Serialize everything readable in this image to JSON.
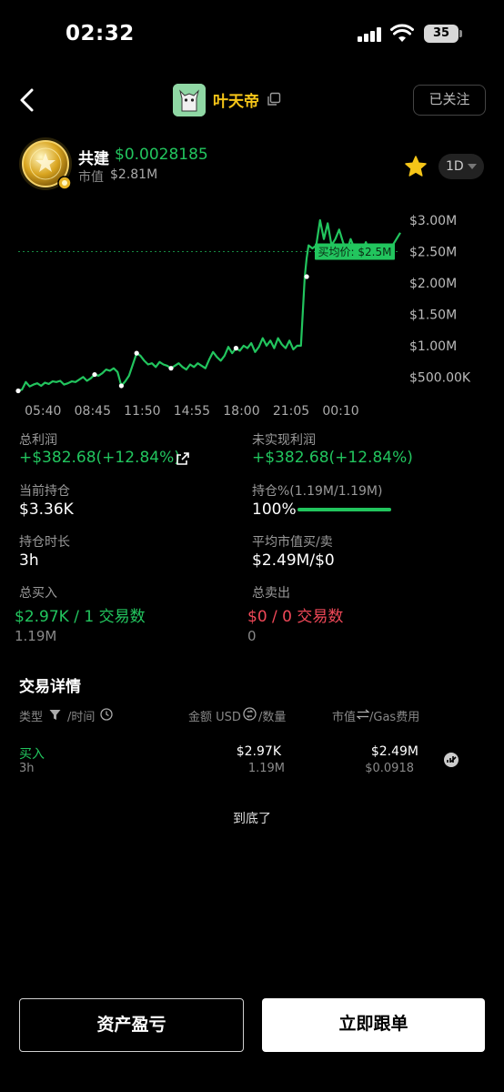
{
  "status_bar": {
    "time": "02:32",
    "battery": "35"
  },
  "header": {
    "name": "叶天帝",
    "follow_label": "已关注"
  },
  "token": {
    "name": "共建",
    "price": "$0.0028185",
    "mcap_label": "市值",
    "mcap_value": "$2.81M",
    "period": "1D"
  },
  "chart_data": {
    "type": "line",
    "y_tick_labels": [
      "$3.00M",
      "$2.50M",
      "$2.00M",
      "$1.50M",
      "$1.00M",
      "$500.00K"
    ],
    "y_ticks": [
      3000000,
      2500000,
      2000000,
      1500000,
      1000000,
      500000
    ],
    "x_tick_labels": [
      "05:40",
      "08:45",
      "11:50",
      "14:55",
      "18:00",
      "21:05",
      "00:10"
    ],
    "ylim": [
      200000,
      3000000
    ],
    "xlim": [
      0,
      100
    ],
    "avg_buy_label": "买均价: $2.5M",
    "avg_buy_value": 2500000,
    "series": [
      {
        "x": [
          0,
          1,
          2,
          3,
          4,
          5,
          6,
          7,
          8,
          9,
          10,
          11,
          12,
          13,
          14,
          15,
          16,
          17,
          18,
          19,
          20,
          21,
          22,
          23,
          24,
          25,
          26,
          27,
          28,
          29,
          30,
          31,
          32,
          33,
          34,
          35,
          36,
          37,
          38,
          39,
          40,
          41,
          42,
          43,
          44,
          45,
          46,
          47,
          48,
          49,
          50,
          51,
          52,
          53,
          54,
          55,
          56,
          57,
          58,
          59,
          60,
          61,
          62,
          63,
          64,
          65,
          66,
          67,
          68,
          69,
          70,
          71,
          72,
          73,
          74,
          75,
          75.5,
          76,
          77,
          78,
          79,
          80,
          81,
          82,
          83,
          84,
          85,
          86,
          87,
          88,
          89,
          90,
          91,
          92,
          93,
          94,
          95,
          96,
          97,
          98,
          99,
          100
        ],
        "values": [
          280000,
          300000,
          420000,
          350000,
          380000,
          400000,
          360000,
          410000,
          390000,
          430000,
          420000,
          440000,
          380000,
          400000,
          430000,
          420000,
          460000,
          500000,
          440000,
          480000,
          540000,
          520000,
          560000,
          620000,
          600000,
          640000,
          580000,
          360000,
          430000,
          520000,
          700000,
          880000,
          840000,
          760000,
          700000,
          720000,
          660000,
          740000,
          700000,
          680000,
          640000,
          680000,
          720000,
          660000,
          620000,
          700000,
          660000,
          720000,
          680000,
          640000,
          780000,
          900000,
          820000,
          760000,
          840000,
          980000,
          880000,
          960000,
          920000,
          1000000,
          960000,
          1040000,
          900000,
          980000,
          1120000,
          1000000,
          1080000,
          960000,
          1120000,
          1020000,
          960000,
          1080000,
          940000,
          1000000,
          1000000,
          2100000,
          2400000,
          2600000,
          2550000,
          2600000,
          3000000,
          2700000,
          2950000,
          2600000,
          2700000,
          2850000,
          2650000,
          2500000,
          2700000,
          2550000,
          2400000,
          2500000,
          2650000,
          2450000,
          2550000,
          2400000,
          2550000,
          2500000,
          2500000,
          2600000,
          2700000,
          2800000
        ]
      }
    ],
    "markers": [
      {
        "x": 0,
        "value": 280000
      },
      {
        "x": 20,
        "value": 540000
      },
      {
        "x": 27,
        "value": 360000
      },
      {
        "x": 31,
        "value": 880000
      },
      {
        "x": 40,
        "value": 640000
      },
      {
        "x": 57,
        "value": 960000
      },
      {
        "x": 75.5,
        "value": 2100000
      }
    ]
  },
  "stats": {
    "total_profit_label": "总利润",
    "total_profit_value": "+$382.68(+12.84%)",
    "unrealized_label": "未实现利润",
    "unrealized_value": "+$382.68(+12.84%)",
    "holding_label": "当前持仓",
    "holding_value": "$3.36K",
    "holding_pct_label": "持仓%(1.19M/1.19M)",
    "holding_pct_value": "100%",
    "holding_pct_fraction": 1.0,
    "duration_label": "持仓时长",
    "duration_value": "3h",
    "avg_mcap_label": "平均市值买/卖",
    "avg_mcap_value": "$2.49M/$0",
    "total_buy_label": "总买入",
    "total_buy_value": "$2.97K / 1 交易数",
    "total_buy_amount": "1.19M",
    "total_sell_label": "总卖出",
    "total_sell_value": "$0 / 0 交易数",
    "total_sell_amount": "0"
  },
  "trades": {
    "title": "交易详情",
    "col_type": "类型",
    "col_time": "/时间",
    "col_amount": "金额 USD",
    "col_qty": "/数量",
    "col_mcap": "市值",
    "col_gas": "/Gas费用",
    "rows": [
      {
        "type": "买入",
        "time": "3h",
        "amount": "$2.97K",
        "qty": "1.19M",
        "mcap": "$2.49M",
        "gas": "$0.0918"
      }
    ],
    "end_text": "到底了"
  },
  "buttons": {
    "pnl": "资产盈亏",
    "copy_trade": "立即跟单"
  },
  "colors": {
    "green": "#22c55e",
    "red": "#f04858",
    "gold": "#f5c518"
  }
}
